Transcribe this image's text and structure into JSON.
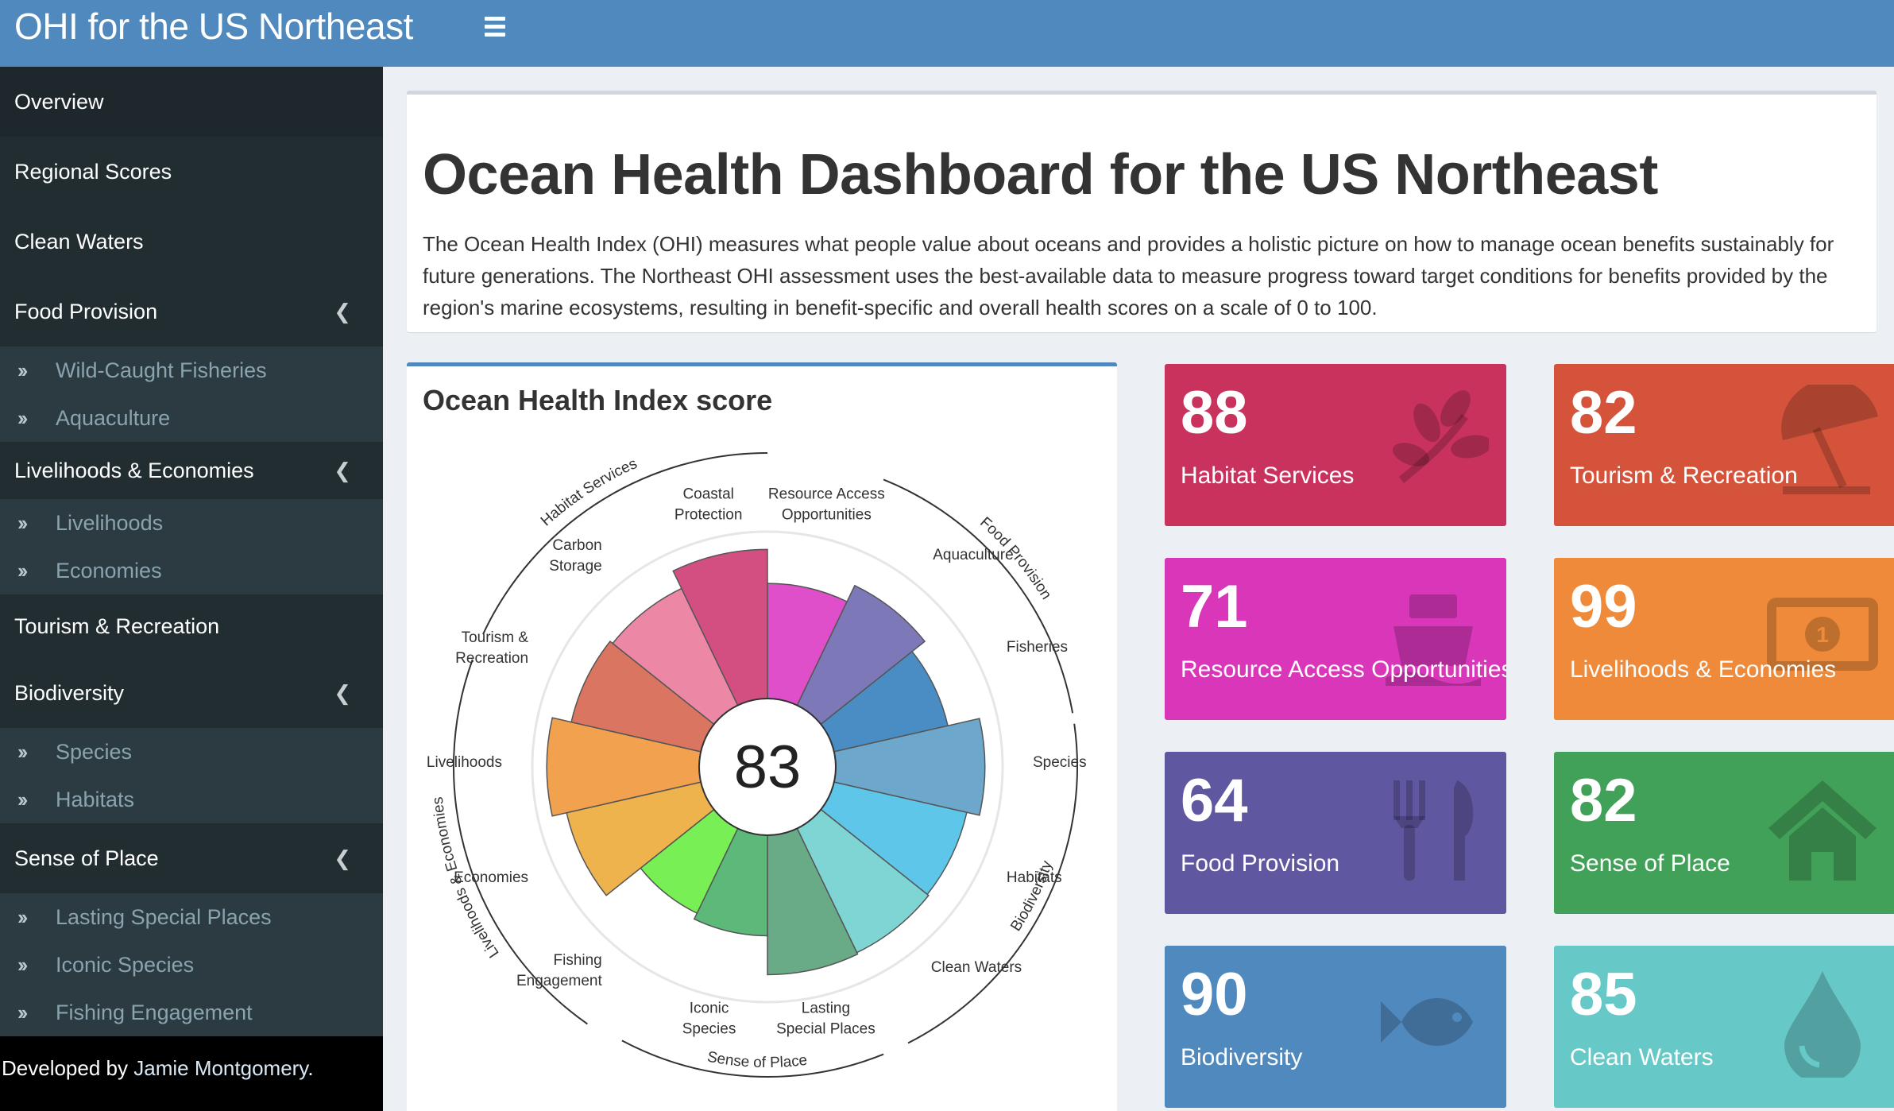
{
  "header": {
    "title": "OHI for the US Northeast",
    "menu_icon": "hamburger-icon"
  },
  "sidebar": {
    "items": [
      {
        "label": "Overview",
        "active": true
      },
      {
        "label": "Regional Scores"
      },
      {
        "label": "Clean Waters"
      },
      {
        "label": "Food Provision",
        "sub": [
          "Wild-Caught Fisheries",
          "Aquaculture"
        ]
      },
      {
        "label": "Livelihoods & Economies",
        "sub": [
          "Livelihoods",
          "Economies"
        ]
      },
      {
        "label": "Tourism & Recreation"
      },
      {
        "label": "Biodiversity",
        "sub": [
          "Species",
          "Habitats"
        ]
      },
      {
        "label": "Sense of Place",
        "sub": [
          "Lasting Special Places",
          "Iconic Species",
          "Fishing Engagement"
        ]
      }
    ],
    "footer_prefix": "Developed by ",
    "footer_link": "Jamie Montgomery",
    "footer_suffix": "."
  },
  "intro": {
    "title": "Ocean Health Dashboard for the US Northeast",
    "text": "The Ocean Health Index (OHI) measures what people value about oceans and provides a holistic picture on how to manage ocean benefits sustainably for future generations. The Northeast OHI assessment uses the best-available data to measure progress toward target conditions for benefits provided by the region's marine ecosystems, resulting in benefit-specific and overall health scores on a scale of 0 to 100."
  },
  "chart": {
    "title": "Ocean Health Index score"
  },
  "chart_data": {
    "type": "flower",
    "center_score": "83",
    "max": 100,
    "petals": [
      {
        "label": "Resource Access Opportunities",
        "value": 71,
        "color": "#df4fc9"
      },
      {
        "label": "Aquaculture",
        "value": 82,
        "color": "#7d79b8"
      },
      {
        "label": "Fisheries",
        "value": 72,
        "color": "#4a8cc4"
      },
      {
        "label": "Species",
        "value": 92,
        "color": "#6ea7cc"
      },
      {
        "label": "Habitats",
        "value": 84,
        "color": "#5ec6e9"
      },
      {
        "label": "Clean Waters",
        "value": 85,
        "color": "#7fd4d4"
      },
      {
        "label": "Lasting Special Places",
        "value": 86,
        "color": "#6aab87"
      },
      {
        "label": "Iconic Species",
        "value": 62,
        "color": "#5cb97a"
      },
      {
        "label": "Fishing Engagement",
        "value": 58,
        "color": "#78f055"
      },
      {
        "label": "Economies",
        "value": 85,
        "color": "#efb34e"
      },
      {
        "label": "Livelihoods",
        "value": 94,
        "color": "#f2a14f"
      },
      {
        "label": "Tourism & Recreation",
        "value": 82,
        "color": "#d97560"
      },
      {
        "label": "Carbon Storage",
        "value": 80,
        "color": "#ec88a6"
      },
      {
        "label": "Coastal Protection",
        "value": 92,
        "color": "#d34f82"
      }
    ],
    "petal_labels": [
      {
        "lines": [
          "Resource Access",
          "Opportunities"
        ]
      },
      {
        "lines": [
          "Aquaculture"
        ]
      },
      {
        "lines": [
          "Fisheries"
        ]
      },
      {
        "lines": [
          "Species"
        ]
      },
      {
        "lines": [
          "Habitats"
        ]
      },
      {
        "lines": [
          "Clean Waters"
        ]
      },
      {
        "lines": [
          "Lasting",
          "Special Places"
        ]
      },
      {
        "lines": [
          "Iconic",
          "Species"
        ]
      },
      {
        "lines": [
          "Fishing",
          "Engagement"
        ]
      },
      {
        "lines": [
          "Economies"
        ]
      },
      {
        "lines": [
          "Livelihoods"
        ]
      },
      {
        "lines": [
          "Tourism &",
          "Recreation"
        ]
      },
      {
        "lines": [
          "Carbon",
          "Storage"
        ]
      },
      {
        "lines": [
          "Coastal",
          "Protection"
        ]
      }
    ],
    "groups": [
      "Habitat Services",
      "Food Provision",
      "Biodiversity",
      "Sense of Place",
      "Livelihoods & Economies"
    ]
  },
  "boxes": [
    {
      "value": "88",
      "label": "Habitat Services",
      "color": "#c8325d",
      "icon": "leaf-icon"
    },
    {
      "value": "82",
      "label": "Tourism & Recreation",
      "color": "#d4533a",
      "icon": "beach-umbrella-icon"
    },
    {
      "value": "71",
      "label": "Resource Access Opportunities",
      "color": "#d936b9",
      "icon": "ship-icon"
    },
    {
      "value": "99",
      "label": "Livelihoods & Economies",
      "color": "#ee8a39",
      "icon": "money-bill-icon"
    },
    {
      "value": "64",
      "label": "Food Provision",
      "color": "#5f579f",
      "icon": "utensils-icon"
    },
    {
      "value": "82",
      "label": "Sense of Place",
      "color": "#42a159",
      "icon": "home-icon"
    },
    {
      "value": "90",
      "label": "Biodiversity",
      "color": "#5089bd",
      "icon": "fish-icon"
    },
    {
      "value": "85",
      "label": "Clean Waters",
      "color": "#67c9c7",
      "icon": "tint-icon"
    }
  ]
}
